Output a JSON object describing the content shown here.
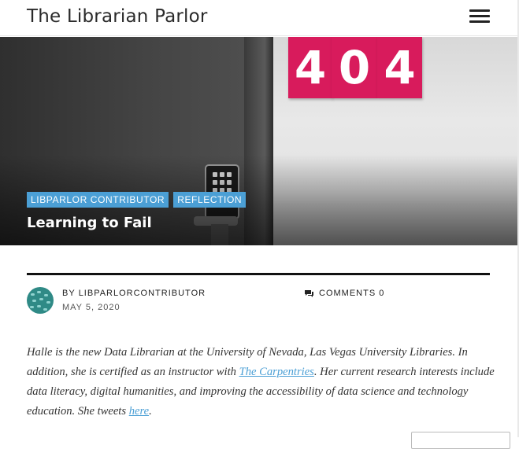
{
  "site": {
    "title": "The Librarian Parlor"
  },
  "hero": {
    "sign_digits": [
      "4",
      "0",
      "4"
    ],
    "tags": [
      "LIBPARLOR CONTRIBUTOR",
      "REFLECTION"
    ],
    "title": "Learning to Fail"
  },
  "meta": {
    "by_label": "BY",
    "author": "LIBPARLORCONTRIBUTOR",
    "date": "MAY 5, 2020",
    "comments_label": "COMMENTS 0"
  },
  "bio": {
    "part1": "Halle is the new Data Librarian at the University of Nevada, Las Vegas University Libraries. In addition, she is certified as an instructor with ",
    "link1": "The Carpentries",
    "part2": ". Her current research interests include data literacy, digital humanities, and improving the accessibility of data science and technology education. She tweets ",
    "link2": "here",
    "part3": "."
  },
  "colors": {
    "tag_bg": "#4b9fd5",
    "sign": "#d81b5c",
    "link": "#4b9fd5"
  },
  "icons": {
    "menu": "hamburger-icon",
    "comments": "comment-bubble-icon"
  }
}
